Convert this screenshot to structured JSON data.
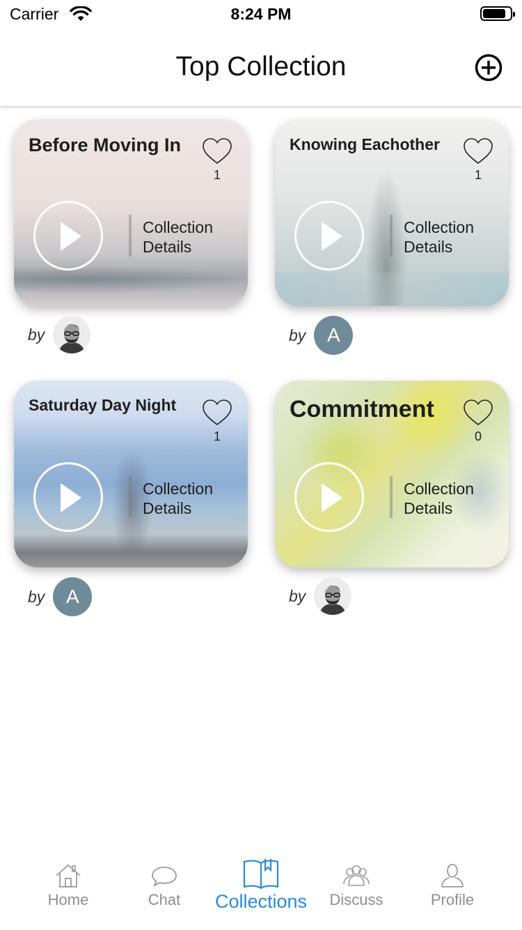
{
  "status_bar": {
    "carrier": "Carrier",
    "time": "8:24 PM"
  },
  "header": {
    "title": "Top Collection"
  },
  "details_label": [
    "Collection",
    "Details"
  ],
  "by_label": "by",
  "cards": [
    {
      "title": "Before Moving In",
      "likes": "1",
      "author_avatar": "photo"
    },
    {
      "title": "Knowing Eachother",
      "likes": "1",
      "author_avatar": "A"
    },
    {
      "title": "Saturday Day Night",
      "likes": "1",
      "author_avatar": "A"
    },
    {
      "title": "Commitment",
      "likes": "0",
      "author_avatar": "photo"
    }
  ],
  "tabs": [
    {
      "label": "Home",
      "icon": "home-icon"
    },
    {
      "label": "Chat",
      "icon": "chat-bubble-icon"
    },
    {
      "label": "Collections",
      "icon": "book-bookmark-icon",
      "active": true
    },
    {
      "label": "Discuss",
      "icon": "group-icon"
    },
    {
      "label": "Profile",
      "icon": "person-icon"
    }
  ],
  "colors": {
    "accent": "#2a8ad8",
    "tab_inactive": "#8e8e8e",
    "avatar_bg": "#6f8a98"
  }
}
